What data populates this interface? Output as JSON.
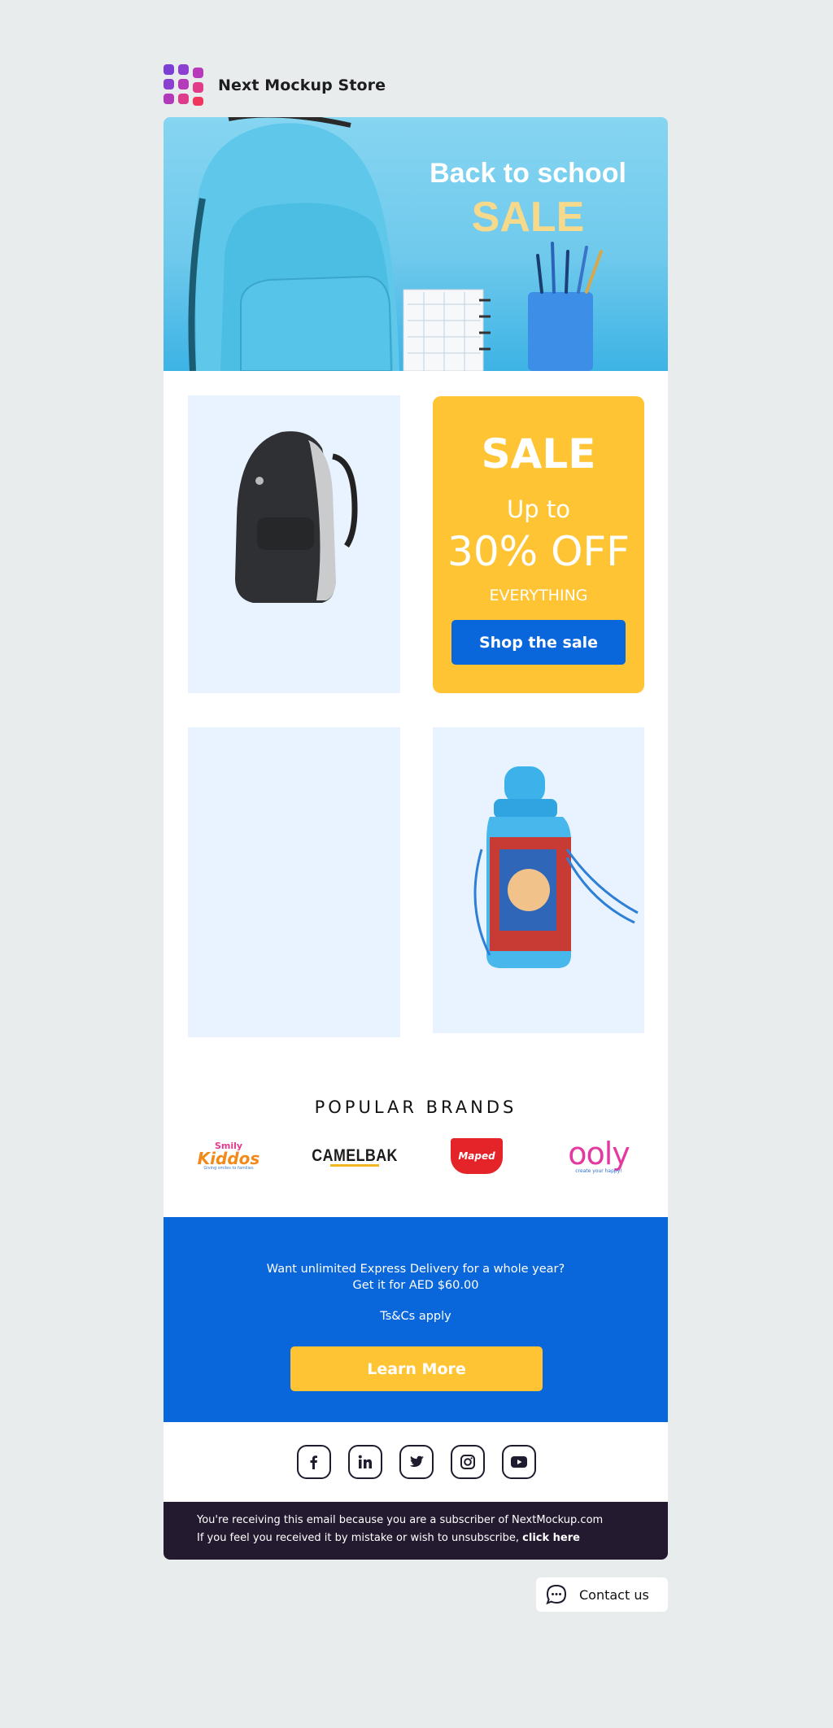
{
  "header": {
    "store_name": "Next Mockup Store"
  },
  "hero": {
    "line1": "Back to school",
    "line2": "SALE"
  },
  "sale_card": {
    "title": "SALE",
    "line1": "Up to",
    "line2": "30% OFF",
    "line3": "EVERYTHING",
    "button": "Shop the sale"
  },
  "brands": {
    "title": "POPULAR BRANDS",
    "items": [
      {
        "name": "Smily Kiddos",
        "text1": "Smily",
        "text2": "Kiddos",
        "tagline": "Giving smiles to families"
      },
      {
        "name": "CAMELBAK",
        "text1": "CAMELBAK"
      },
      {
        "name": "Maped",
        "text1": "Maped"
      },
      {
        "name": "ooly",
        "text1": "ooly",
        "tagline": "create your happy!"
      }
    ]
  },
  "promo": {
    "line1": "Want unlimited Express Delivery for a whole year?",
    "line2": "Get it for AED $60.00",
    "line3": "Ts&Cs apply",
    "button": "Learn More"
  },
  "social": [
    "facebook-icon",
    "linkedin-icon",
    "twitter-icon",
    "instagram-icon",
    "youtube-icon"
  ],
  "footer": {
    "line1": "You're receiving this email because you are a subscriber of NextMockup.com",
    "line2": "If you feel you received it by mistake or wish to unsubscribe,",
    "link": "click here"
  },
  "contact": {
    "label": "Contact us"
  },
  "colors": {
    "brand_blue": "#0a66db",
    "accent_yellow": "#ffc434",
    "footer_dark": "#241a30",
    "card_bg": "#e8f3ff"
  }
}
